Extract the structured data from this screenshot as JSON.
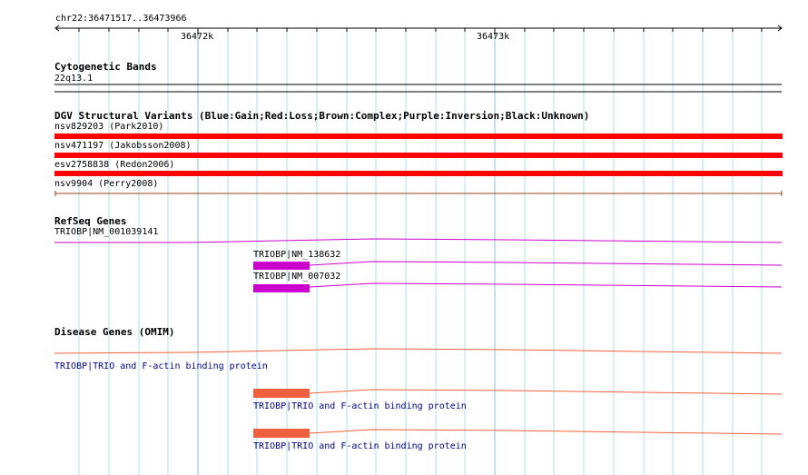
{
  "ruler": {
    "range": "chr22:36471517..36473966",
    "ticks": [
      "36472k",
      "36473k"
    ]
  },
  "cytoband": {
    "title": "Cytogenetic Bands",
    "band": "22q13.1"
  },
  "dgv": {
    "title": "DGV Structural Variants (Blue:Gain;Red:Loss;Brown:Complex;Purple:Inversion;Black:Unknown)",
    "variants": [
      {
        "label": "nsv829203 (Park2010)",
        "type": "loss",
        "color": "#ff0000"
      },
      {
        "label": "nsv471197 (Jakobsson2008)",
        "type": "loss",
        "color": "#ff0000"
      },
      {
        "label": "esv2758838 (Redon2006)",
        "type": "loss",
        "color": "#ff0000"
      },
      {
        "label": "nsv9904 (Perry2008)",
        "type": "complex",
        "color": "#8b4513"
      }
    ]
  },
  "refseq": {
    "title": "RefSeq Genes",
    "genes": [
      {
        "label": "TRIOBP|NM_001039141"
      },
      {
        "label": "TRIOBP|NM_138632"
      },
      {
        "label": "TRIOBP|NM_007032"
      }
    ],
    "color": "#cc00cc"
  },
  "omim": {
    "title": "Disease Genes (OMIM)",
    "genes": [
      {
        "label": "TRIOBP|TRIO and F-actin binding protein"
      },
      {
        "label": "TRIOBP|TRIO and F-actin binding protein"
      },
      {
        "label": "TRIOBP|TRIO and F-actin binding protein"
      }
    ],
    "color": "#f0603f"
  },
  "colors": {
    "gridline": "#aee0f0",
    "gridline_major": "#7ec8e3",
    "label_blue": "#00008b"
  }
}
